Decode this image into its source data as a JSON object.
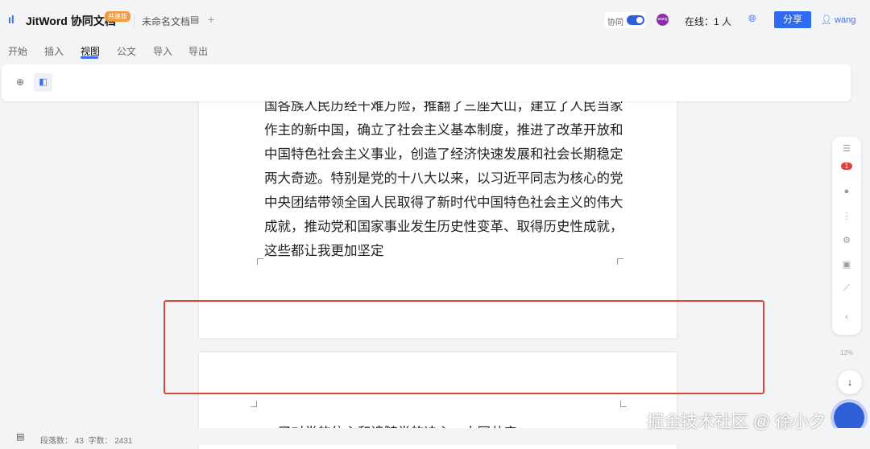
{
  "header": {
    "app_title": "JitWord 协同文档",
    "edition_badge": "共建版",
    "doc_name": "未命名文档",
    "collab_label": "协同",
    "avatar_text": "wang",
    "online": "在线：1 人",
    "share": "分享",
    "user": "wang"
  },
  "tabs": [
    "开始",
    "插入",
    "视图",
    "公文",
    "导入",
    "导出"
  ],
  "active_tab": "视图",
  "document": {
    "lines": [
      "国各族人民历经千难万险，推翻了三座大山，建立了人民当家",
      "作主的新中国，确立了社会主义基本制度，推进了改革开放和",
      "中国特色社会主义事业，创造了经济快速发展和社会长期稳定",
      "两大奇迹。特别是党的十八大以来，以习近平同志为核心的党",
      "中央团结带领全国人民取得了新时代中国特色社会主义的伟大",
      "成就，推动党和国家事业发生历史性变革、取得历史性成就，",
      "这些都让我更加坚定"
    ],
    "next_page_line": "了对党的信心和追随党的决心，中国共产"
  },
  "sidebar": {
    "comment_count": "1",
    "progress": "12%"
  },
  "status": {
    "paragraphs_label": "段落数：",
    "paragraphs": "43",
    "words_label": "字数：",
    "words": "2431"
  },
  "watermark": "掘金技术社区 @ 徐小夕"
}
